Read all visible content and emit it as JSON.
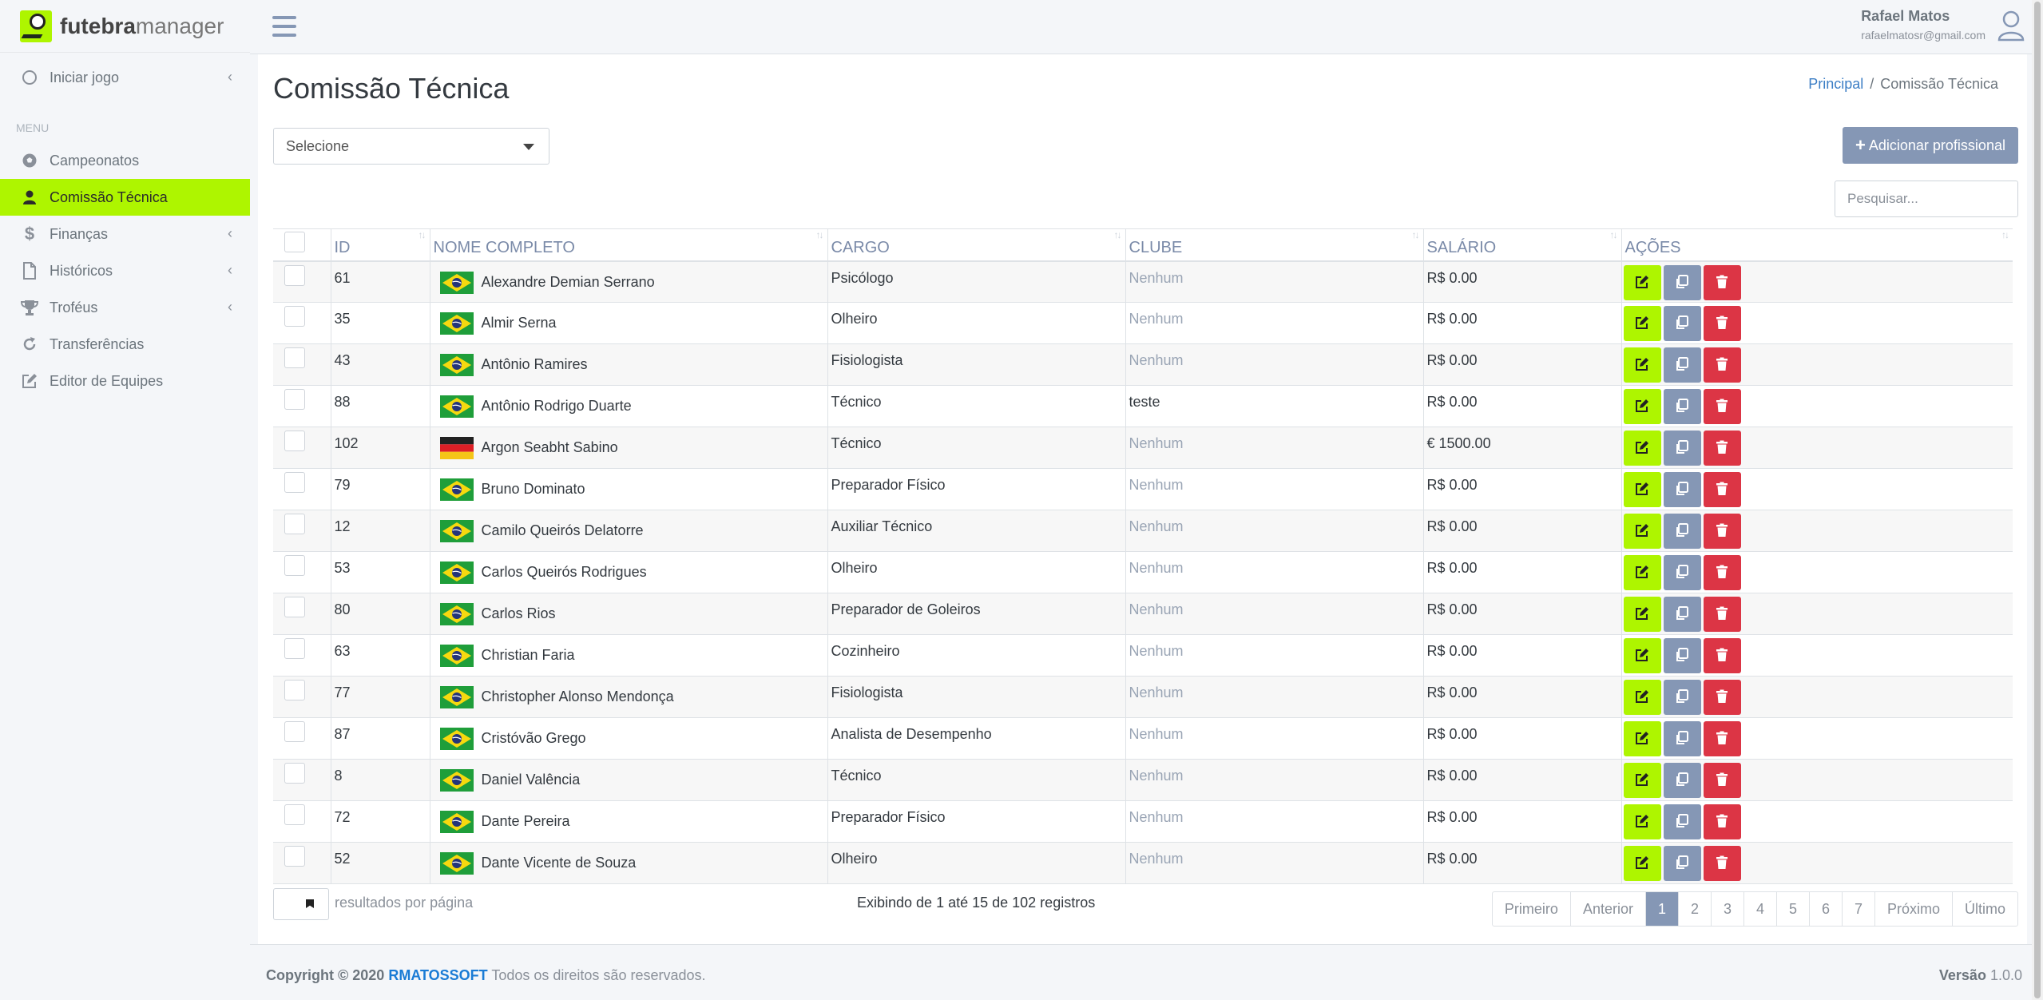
{
  "brand": {
    "bold": "futebra",
    "light": "manager"
  },
  "sidebar": {
    "start_item": {
      "label": "Iniciar jogo",
      "icon": "circle-icon"
    },
    "menu_header": "MENU",
    "items": [
      {
        "label": "Campeonatos",
        "icon": "soccer-ball-icon",
        "has_chevron": false
      },
      {
        "label": "Comissão Técnica",
        "icon": "user-icon",
        "has_chevron": false,
        "active": true
      },
      {
        "label": "Finanças",
        "icon": "dollar-icon",
        "has_chevron": true
      },
      {
        "label": "Históricos",
        "icon": "file-icon",
        "has_chevron": true
      },
      {
        "label": "Troféus",
        "icon": "trophy-icon",
        "has_chevron": true
      },
      {
        "label": "Transferências",
        "icon": "refresh-icon",
        "has_chevron": false
      },
      {
        "label": "Editor de Equipes",
        "icon": "edit-icon",
        "has_chevron": false
      }
    ]
  },
  "topbar": {
    "user_name": "Rafael Matos",
    "user_email": "rafaelmatosr@gmail.com"
  },
  "page": {
    "title": "Comissão Técnica",
    "breadcrumb_home": "Principal",
    "breadcrumb_current": "Comissão Técnica"
  },
  "filter": {
    "select_value": "Selecione"
  },
  "add_button": {
    "label": "Adicionar profissional"
  },
  "search": {
    "placeholder": "Pesquisar..."
  },
  "table": {
    "columns": [
      "ID",
      "NOME COMPLETO",
      "CARGO",
      "CLUBE",
      "SALÁRIO",
      "AÇÕES"
    ],
    "rows": [
      {
        "id": "61",
        "name": "Alexandre Demian Serrano",
        "flag": "brazil",
        "cargo": "Psicólogo",
        "clube": "Nenhum",
        "salario": "R$ 0.00"
      },
      {
        "id": "35",
        "name": "Almir Serna",
        "flag": "brazil",
        "cargo": "Olheiro",
        "clube": "Nenhum",
        "salario": "R$ 0.00"
      },
      {
        "id": "43",
        "name": "Antônio Ramires",
        "flag": "brazil",
        "cargo": "Fisiologista",
        "clube": "Nenhum",
        "salario": "R$ 0.00"
      },
      {
        "id": "88",
        "name": "Antônio Rodrigo Duarte",
        "flag": "brazil",
        "cargo": "Técnico",
        "clube": "teste",
        "salario": "R$ 0.00"
      },
      {
        "id": "102",
        "name": "Argon Seabht Sabino",
        "flag": "germany",
        "cargo": "Técnico",
        "clube": "Nenhum",
        "salario": "€ 1500.00"
      },
      {
        "id": "79",
        "name": "Bruno Dominato",
        "flag": "brazil",
        "cargo": "Preparador Físico",
        "clube": "Nenhum",
        "salario": "R$ 0.00"
      },
      {
        "id": "12",
        "name": "Camilo Queirós Delatorre",
        "flag": "brazil",
        "cargo": "Auxiliar Técnico",
        "clube": "Nenhum",
        "salario": "R$ 0.00"
      },
      {
        "id": "53",
        "name": "Carlos Queirós Rodrigues",
        "flag": "brazil",
        "cargo": "Olheiro",
        "clube": "Nenhum",
        "salario": "R$ 0.00"
      },
      {
        "id": "80",
        "name": "Carlos Rios",
        "flag": "brazil",
        "cargo": "Preparador de Goleiros",
        "clube": "Nenhum",
        "salario": "R$ 0.00"
      },
      {
        "id": "63",
        "name": "Christian Faria",
        "flag": "brazil",
        "cargo": "Cozinheiro",
        "clube": "Nenhum",
        "salario": "R$ 0.00"
      },
      {
        "id": "77",
        "name": "Christopher Alonso Mendonça",
        "flag": "brazil",
        "cargo": "Fisiologista",
        "clube": "Nenhum",
        "salario": "R$ 0.00"
      },
      {
        "id": "87",
        "name": "Cristóvão Grego",
        "flag": "brazil",
        "cargo": "Analista de Desempenho",
        "clube": "Nenhum",
        "salario": "R$ 0.00"
      },
      {
        "id": "8",
        "name": "Daniel Valência",
        "flag": "brazil",
        "cargo": "Técnico",
        "clube": "Nenhum",
        "salario": "R$ 0.00"
      },
      {
        "id": "72",
        "name": "Dante Pereira",
        "flag": "brazil",
        "cargo": "Preparador Físico",
        "clube": "Nenhum",
        "salario": "R$ 0.00"
      },
      {
        "id": "52",
        "name": "Dante Vicente de Souza",
        "flag": "brazil",
        "cargo": "Olheiro",
        "clube": "Nenhum",
        "salario": "R$ 0.00"
      }
    ]
  },
  "table_footer": {
    "per_page_label": "resultados por página",
    "info": "Exibindo de 1 até 15 de 102 registros",
    "pager": {
      "first": "Primeiro",
      "prev": "Anterior",
      "pages": [
        "1",
        "2",
        "3",
        "4",
        "5",
        "6",
        "7"
      ],
      "current": "1",
      "next": "Próximo",
      "last": "Último"
    }
  },
  "footer": {
    "copyright": "Copyright © 2020",
    "company": "RMATOSSOFT",
    "rights": "Todos os direitos são reservados.",
    "version_label": "Versão",
    "version": "1.0.0"
  },
  "colors": {
    "accent": "#aef500",
    "secondary": "#8597b5",
    "danger": "#dc3545",
    "link": "#3c7ec5"
  }
}
